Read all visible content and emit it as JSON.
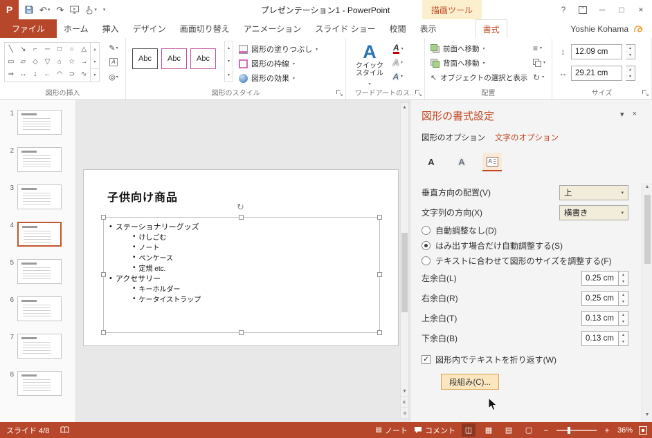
{
  "colors": {
    "accent": "#B7472A",
    "accent_text": "#C0461F",
    "theme_magenta": "#C24E9E"
  },
  "titlebar": {
    "title": "プレゼンテーション1 - PowerPoint",
    "context_group": "描画ツール"
  },
  "tabs": [
    {
      "label": "ファイル"
    },
    {
      "label": "ホーム"
    },
    {
      "label": "挿入"
    },
    {
      "label": "デザイン"
    },
    {
      "label": "画面切り替え"
    },
    {
      "label": "アニメーション"
    },
    {
      "label": "スライド ショー"
    },
    {
      "label": "校閲"
    },
    {
      "label": "表示"
    },
    {
      "label": "書式",
      "active": true
    }
  ],
  "user": "Yoshie Kohama",
  "icons": {
    "logo": "P",
    "undo": "↶",
    "redo": "↷",
    "caret_down": "▾",
    "caret_up": "▴",
    "spin_up": "▲",
    "spin_down": "▼",
    "scroll_up": "▲",
    "scroll_down": "▼",
    "double_chevron": "«",
    "close": "×",
    "minimize": "─",
    "maximize": "□",
    "help": "?",
    "ribbon_options": "^",
    "rotate": "↻",
    "height": "↕",
    "width": "↔",
    "align": "≡",
    "check": "✓",
    "pencil": "✎",
    "letter_a": "A",
    "merge": "◎",
    "more": "▾",
    "launcher": "↘",
    "select": "↖",
    "notes": "▤",
    "views": [
      "◫",
      "▦",
      "▤",
      "▢"
    ],
    "zoom_out": "−",
    "zoom_in": "+",
    "shapes": [
      "╲",
      "↘",
      "⌐",
      "─",
      "□",
      "○",
      "△",
      "▭",
      "▱",
      "◇",
      "▽",
      "⌂",
      "☆",
      "→",
      "⇒",
      "↔",
      "↕",
      "←",
      "◠",
      "⊃",
      "∿"
    ]
  },
  "ribbon": {
    "groups": {
      "insert_shapes": {
        "label": "図形の挿入"
      },
      "shape_styles": {
        "label": "図形のスタイル",
        "samples": [
          "Abc",
          "Abc",
          "Abc"
        ],
        "fill": "図形の塗りつぶし",
        "outline": "図形の枠線",
        "effects": "図形の効果"
      },
      "wordart": {
        "label": "ワードアートのス...",
        "quick_style": "クイック スタイル"
      },
      "arrange": {
        "label": "配置",
        "bring_front": "前面へ移動",
        "send_back": "背面へ移動",
        "selection_pane": "オブジェクトの選択と表示"
      },
      "size": {
        "label": "サイズ",
        "height_value": "12.09 cm",
        "width_value": "29.21 cm"
      }
    }
  },
  "thumbs": {
    "selected": "4",
    "items": [
      {
        "n": "1"
      },
      {
        "n": "2"
      },
      {
        "n": "3"
      },
      {
        "n": "4"
      },
      {
        "n": "5"
      },
      {
        "n": "6"
      },
      {
        "n": "7"
      },
      {
        "n": "8"
      }
    ]
  },
  "slide": {
    "title": "子供向け商品",
    "bullets": [
      {
        "level": 1,
        "text": "ステーショナリーグッズ"
      },
      {
        "level": 2,
        "text": "けしごむ"
      },
      {
        "level": 2,
        "text": "ノート"
      },
      {
        "level": 2,
        "text": "ペンケース"
      },
      {
        "level": 2,
        "text": "定規 etc."
      },
      {
        "level": 1,
        "text": "アクセサリー"
      },
      {
        "level": 2,
        "text": "キーホルダー"
      },
      {
        "level": 2,
        "text": "ケータイストラップ"
      }
    ]
  },
  "pane": {
    "title": "図形の書式設定",
    "tab_shape": "図形のオプション",
    "tab_text": "文字のオプション",
    "vertical_alignment": {
      "label": "垂直方向の配置(V)",
      "value": "上"
    },
    "text_direction": {
      "label": "文字列の方向(X)",
      "value": "横書き"
    },
    "radios": [
      {
        "label": "自動調整なし(D)",
        "checked": false
      },
      {
        "label": "はみ出す場合だけ自動調整する(S)",
        "checked": true
      },
      {
        "label": "テキストに合わせて図形のサイズを調整する(F)",
        "checked": false
      }
    ],
    "margins": [
      {
        "label": "左余白(L)",
        "value": "0.25 cm"
      },
      {
        "label": "右余白(R)",
        "value": "0.25 cm"
      },
      {
        "label": "上余白(T)",
        "value": "0.13 cm"
      },
      {
        "label": "下余白(B)",
        "value": "0.13 cm"
      }
    ],
    "wrap_checkbox": "図形内でテキストを折り返す(W)",
    "columns_button": "段組み(C)..."
  },
  "statusbar": {
    "slide_indicator": "スライド 4/8",
    "notes": "ノート",
    "comments": "コメント",
    "zoom": "36%"
  }
}
